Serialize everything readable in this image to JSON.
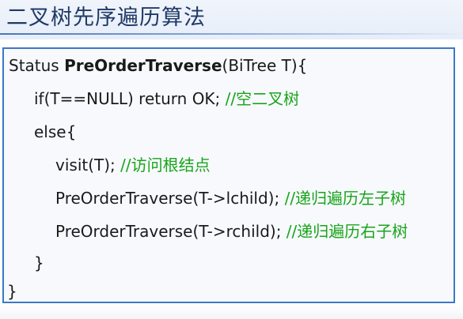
{
  "header": {
    "title": "二叉树先序遍历算法"
  },
  "code": {
    "l1_prefix": "Status ",
    "l1_func": "PreOrderTraverse",
    "l1_suffix": "(BiTree T){",
    "l2_code": "if(T==NULL) return OK; ",
    "l2_comment": "//空二叉树",
    "l3_code": "else{",
    "l4_code": "visit(T); ",
    "l4_comment": "//访问根结点",
    "l5_code": "PreOrderTraverse(T->lchild); ",
    "l5_comment": "//递归遍历左子树",
    "l6_code": "PreOrderTraverse(T->rchild); ",
    "l6_comment": "//递归遍历右子树",
    "l7_code": "}",
    "l8_code": "}"
  },
  "colors": {
    "title": "#1f3a66",
    "border": "#3b78c8",
    "comment": "#18a51a",
    "text": "#1a1a1a"
  }
}
